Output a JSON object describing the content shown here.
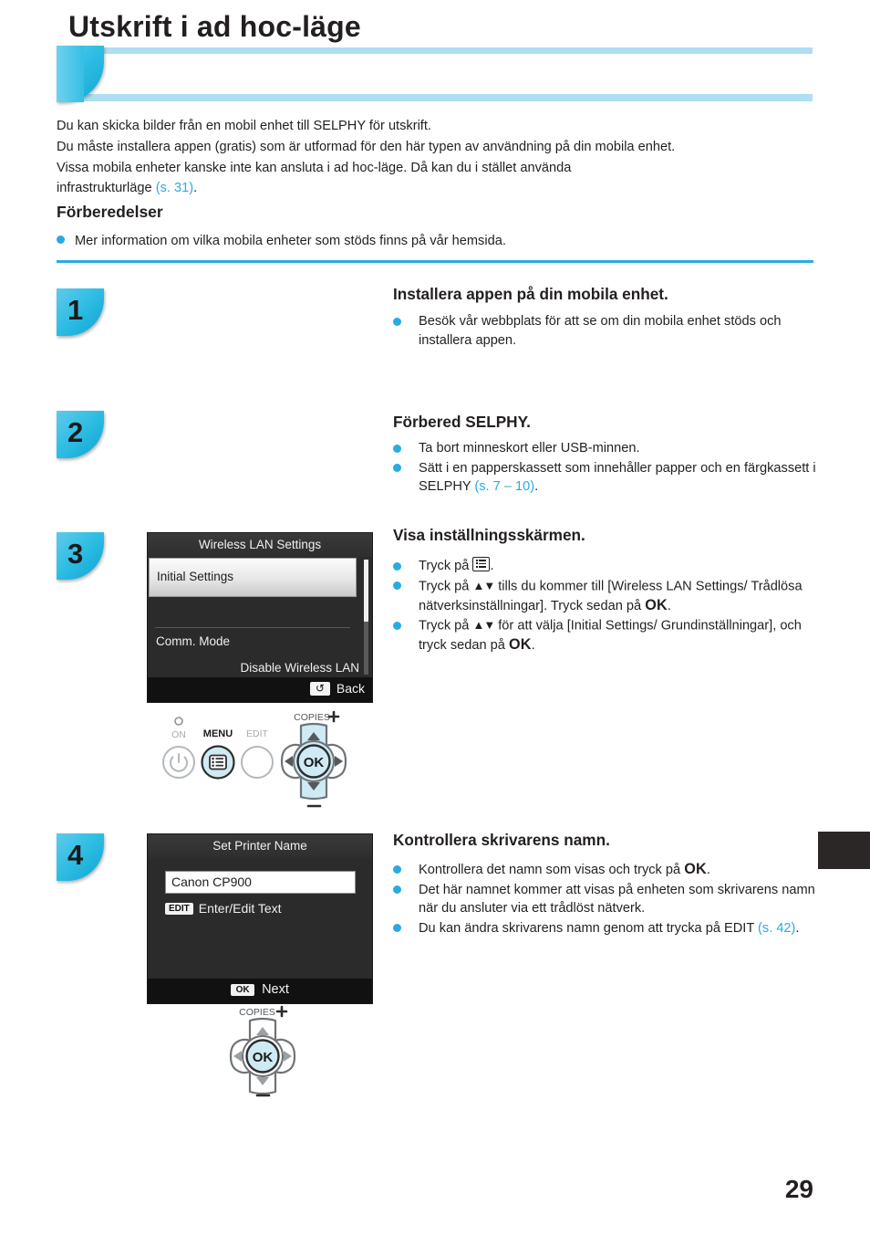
{
  "header": {
    "title": "Utskrift i ad hoc-läge",
    "accent_color": "#29abe2",
    "banner_color": "#addff2"
  },
  "intro": {
    "line1": "Du kan skicka bilder från en mobil enhet till SELPHY för utskrift.",
    "line2": "Du måste installera appen (gratis) som är utformad för den här typen av användning på din mobila enhet.",
    "line3": "Vissa mobila enheter kanske inte kan ansluta i ad hoc-läge. Då kan du i stället använda",
    "line4_prefix": "infrastrukturläge ",
    "line4_link": "(s. 31)",
    "line4_suffix": "."
  },
  "preparations": {
    "heading": "Förberedelser",
    "bullet": "Mer information om vilka mobila enheter som stöds finns på vår hemsida."
  },
  "steps": [
    {
      "number": "1",
      "title": "Installera appen på din mobila enhet.",
      "bullets": [
        "Besök vår webbplats för att se om din mobila enhet stöds och installera appen."
      ]
    },
    {
      "number": "2",
      "title": "Förbered SELPHY.",
      "bullets": [
        "Ta bort minneskort eller USB-minnen.",
        "Sätt i en papperskassett som innehåller papper och en färgkassett i SELPHY (s. 7 – 10)."
      ],
      "bullet2_prefix": "Sätt i en papperskassett som innehåller papper och en färgkassett i SELPHY ",
      "bullet2_link": "(s. 7 – 10)",
      "bullet2_suffix": "."
    },
    {
      "number": "3",
      "title": "Visa inställningsskärmen.",
      "bullets": [
        "Tryck på .",
        "Tryck på ▲▼ tills du kommer till [Wireless LAN Settings/Trådlösa nätverksinställningar]. Tryck sedan på OK.",
        "Tryck på ▲▼ för att välja [Initial Settings/Grundinställningar], och tryck sedan på OK."
      ],
      "b1_prefix": "Tryck på ",
      "b1_suffix": ".",
      "b2_prefix": "Tryck på ",
      "b2_arrows": "▲▼",
      "b2_mid": " tills du kommer till [Wireless LAN Settings/ Trådlösa nätverksinställningar]. Tryck sedan på ",
      "b2_ok": "OK",
      "b2_suffix": ".",
      "b3_prefix": "Tryck på ",
      "b3_arrows": "▲▼",
      "b3_mid": " för att välja [Initial Settings/ Grundinställningar], och tryck sedan på ",
      "b3_ok": "OK",
      "b3_suffix": "."
    },
    {
      "number": "4",
      "title": "Kontrollera skrivarens namn.",
      "bullets": [
        "Kontrollera det namn som visas och tryck på OK.",
        "Det här namnet kommer att visas på enheten som skrivarens namn när du ansluter via ett trådlöst nätverk.",
        "Du kan ändra skrivarens namn genom att trycka på EDIT (s. 42)."
      ],
      "b1_prefix": "Kontrollera det namn som visas och tryck på ",
      "b1_ok": "OK",
      "b1_suffix": ".",
      "b2_text": "Det här namnet kommer att visas på enheten som skrivarens namn när du ansluter via ett trådlöst nätverk.",
      "b3_prefix": "Du kan ändra skrivarens namn genom att trycka på EDIT ",
      "b3_link": "(s. 42)",
      "b3_suffix": "."
    }
  ],
  "lcd_wlan": {
    "title": "Wireless LAN Settings",
    "selected_item": "Initial Settings",
    "item2_label": "Comm. Mode",
    "item2_value": "Disable Wireless LAN",
    "footer_button": "Back",
    "footer_icon": "back-arrow-icon"
  },
  "lcd_printer_name": {
    "title": "Set Printer Name",
    "name_value": "Canon CP900",
    "edit_chip": "EDIT",
    "edit_label": "Enter/Edit Text",
    "footer_chip": "OK",
    "footer_button": "Next"
  },
  "control_panel_step3": {
    "power_label": "ON",
    "menu_label": "MENU",
    "edit_label": "EDIT",
    "copies_label": "COPIES",
    "ok_label": "OK",
    "plus_symbol": "+",
    "minus_symbol": "–",
    "highlight_color": "#cfeaf5"
  },
  "control_panel_step4": {
    "copies_label": "COPIES",
    "ok_label": "OK",
    "plus_symbol": "+",
    "minus_symbol": "–",
    "highlight_color": "#cfeaf5"
  },
  "footer": {
    "page_number": "29"
  }
}
